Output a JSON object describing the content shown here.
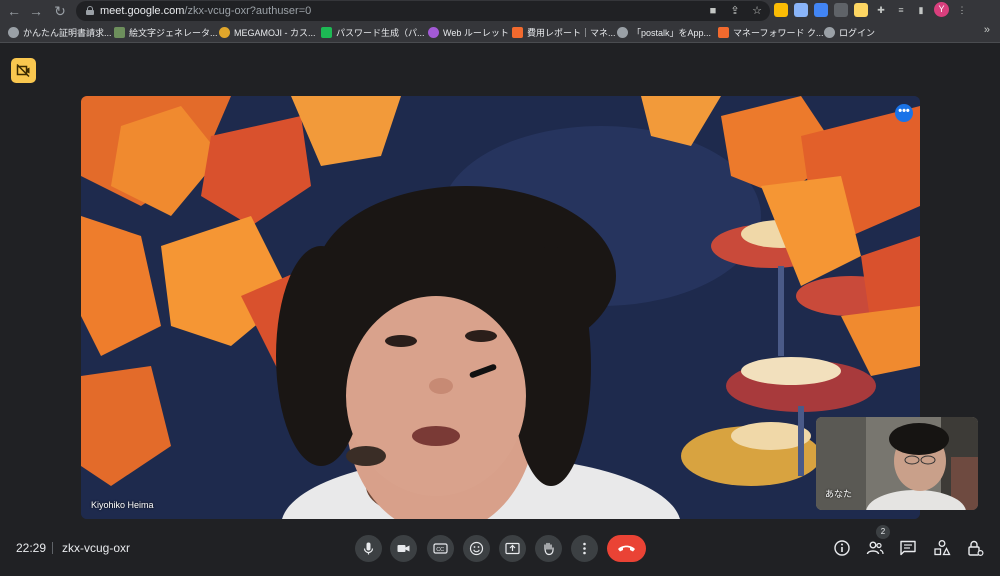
{
  "browser": {
    "url_host": "meet.google.com",
    "url_path": "/zkx-vcug-oxr?authuser=0",
    "profile_initial": "Y",
    "bookmarks": [
      {
        "label": "かんたん証明書請求...",
        "color": "#9aa0a6"
      },
      {
        "label": "絵文字ジェネレータ...",
        "color": "#6d8f5c"
      },
      {
        "label": "MEGAMOJI - カス...",
        "color": "#e0a62b"
      },
      {
        "label": "パスワード生成（パ...",
        "color": "#1db954"
      },
      {
        "label": "Web ルーレット",
        "color": "#a35ad6"
      },
      {
        "label": "費用レポート｜マネ...",
        "color": "#f26a2e"
      },
      {
        "label": "「postalk」をApp...",
        "color": "#9aa0a6"
      },
      {
        "label": "マネーフォワード ク...",
        "color": "#f26a2e"
      },
      {
        "label": "ログイン",
        "color": "#9aa0a6"
      }
    ],
    "bookmarks_more": "»"
  },
  "meet": {
    "main_participant": "Kiyohiko Heima",
    "self_label": "あなた",
    "time": "22:29",
    "meeting_code": "zkx-vcug-oxr",
    "participant_count": "2"
  },
  "colors": {
    "accent_blue": "#1a73e8",
    "end_call_red": "#ea4335",
    "cam_badge_yellow": "#f9c74f",
    "bg": "#202124"
  }
}
